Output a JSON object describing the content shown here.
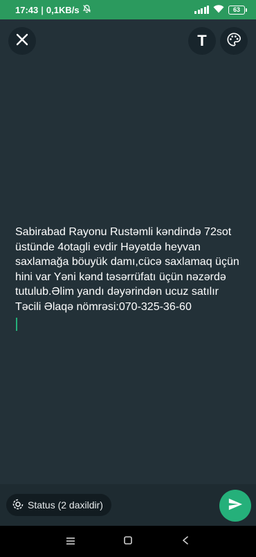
{
  "status_bar": {
    "time": "17:43",
    "separator": "|",
    "network_speed": "0,1KB/s",
    "battery": "63",
    "icons": [
      "mute-icon",
      "signal-icon",
      "wifi-icon",
      "battery-icon"
    ]
  },
  "toolbar": {
    "close_icon": "close-icon",
    "text_button_label": "T",
    "palette_icon": "palette-icon"
  },
  "composer": {
    "text": "Sabirabad Rayonu Rustəmli kəndində 72sot üstünde 4otagli evdir Həyətdə heyvan saxlamağa böuyük damı,cücə saxlamaq üçün hini var Yəni kənd təsərrüfatı üçün nəzərdə tutulub.Əlim yandı dəyərindən ucuz satılır Təcili Əlaqə nömrəsi:070-325-36-60"
  },
  "bottom_bar": {
    "status_audience": "Status (2 daxildir)",
    "status_icon": "status-icon",
    "send_icon": "send-icon"
  },
  "nav_bar": {
    "icons": [
      "menu-icon",
      "home-icon",
      "back-icon"
    ]
  },
  "colors": {
    "status_bar": "#2b9a5e",
    "background": "#233138",
    "accent": "#25b07a",
    "button_bg": "#18252c"
  }
}
